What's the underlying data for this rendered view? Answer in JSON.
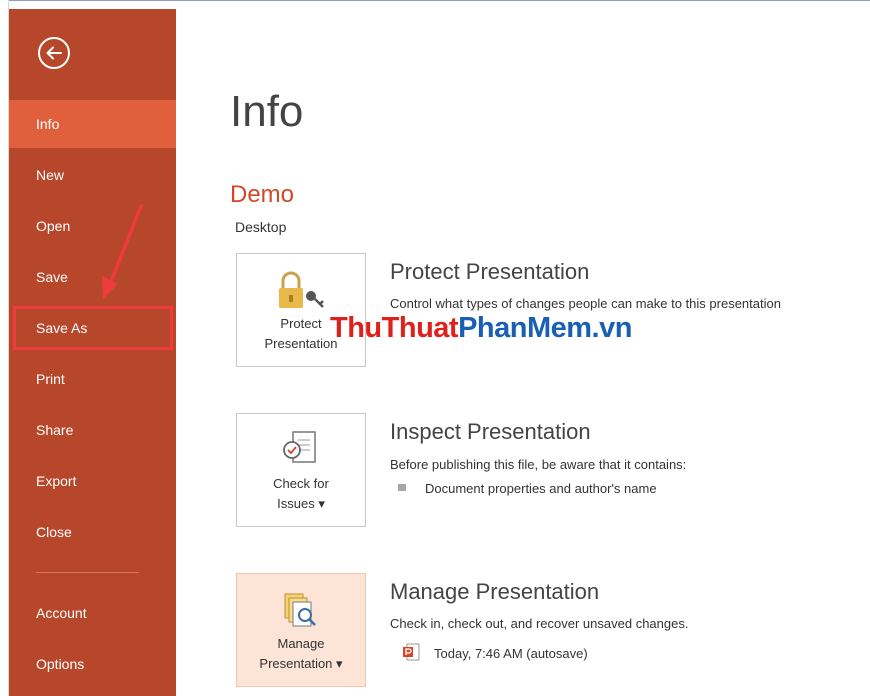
{
  "sidebar": {
    "items": [
      {
        "label": "Info",
        "active": true
      },
      {
        "label": "New"
      },
      {
        "label": "Open"
      },
      {
        "label": "Save"
      },
      {
        "label": "Save As"
      },
      {
        "label": "Print"
      },
      {
        "label": "Share"
      },
      {
        "label": "Export"
      },
      {
        "label": "Close"
      },
      {
        "label": "Account"
      },
      {
        "label": "Options"
      }
    ]
  },
  "main": {
    "title": "Info",
    "doc_name": "Demo",
    "doc_location": "Desktop",
    "protect": {
      "tile_label_1": "Protect",
      "tile_label_2": "Presentation",
      "title": "Protect Presentation",
      "description": "Control what types of changes people can make to this presentation"
    },
    "inspect": {
      "tile_label_1": "Check for",
      "tile_label_2": "Issues ▾",
      "title": "Inspect Presentation",
      "description": "Before publishing this file, be aware that it contains:",
      "bullet": "Document properties and author's name"
    },
    "manage": {
      "tile_label_1": "Manage",
      "tile_label_2": "Presentation ▾",
      "title": "Manage Presentation",
      "description": "Check in, check out, and recover unsaved changes.",
      "version": "Today, 7:46 AM (autosave)"
    }
  },
  "watermark": {
    "part1": "ThuThuat",
    "part2": "PhanMem.vn"
  },
  "colors": {
    "accent": "#b7472a",
    "active": "#e0603e",
    "title": "#d24726",
    "annotation": "#ef3b3b"
  }
}
